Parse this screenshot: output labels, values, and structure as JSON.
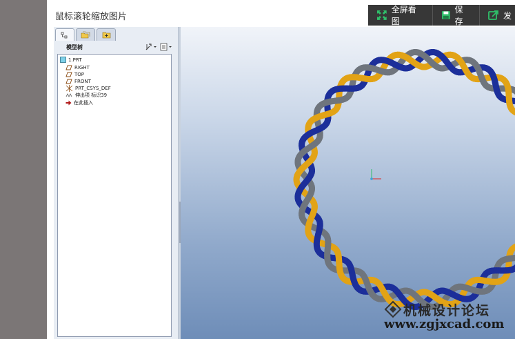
{
  "page": {
    "title": "鼠标滚轮缩放图片"
  },
  "toolbar": {
    "fullscreen_label": "全屏看图",
    "save_label": "保存",
    "send_label": "发"
  },
  "model_tree": {
    "title": "模型树",
    "items": [
      {
        "label": "1.PRT",
        "icon": "part-icon"
      },
      {
        "label": "RIGHT",
        "icon": "datum-plane-icon"
      },
      {
        "label": "TOP",
        "icon": "datum-plane-icon"
      },
      {
        "label": "FRONT",
        "icon": "datum-plane-icon"
      },
      {
        "label": "PRT_CSYS_DEF",
        "icon": "coordinate-system-icon"
      },
      {
        "label": "伸出项 标识39",
        "icon": "extrude-feature-icon"
      },
      {
        "label": "在此插入",
        "icon": "insert-arrow-icon"
      }
    ]
  },
  "watermark": {
    "site_name": "机械设计论坛",
    "url": "www.zgjxcad.com"
  },
  "colors": {
    "strand_gold": "#e2a316",
    "strand_blue": "#1c2f9a",
    "strand_gray": "#6f757d",
    "toolbar_bg": "#373737",
    "fullscreen_icon": "#2fbf6a",
    "save_icon": "#2fbf6a"
  }
}
